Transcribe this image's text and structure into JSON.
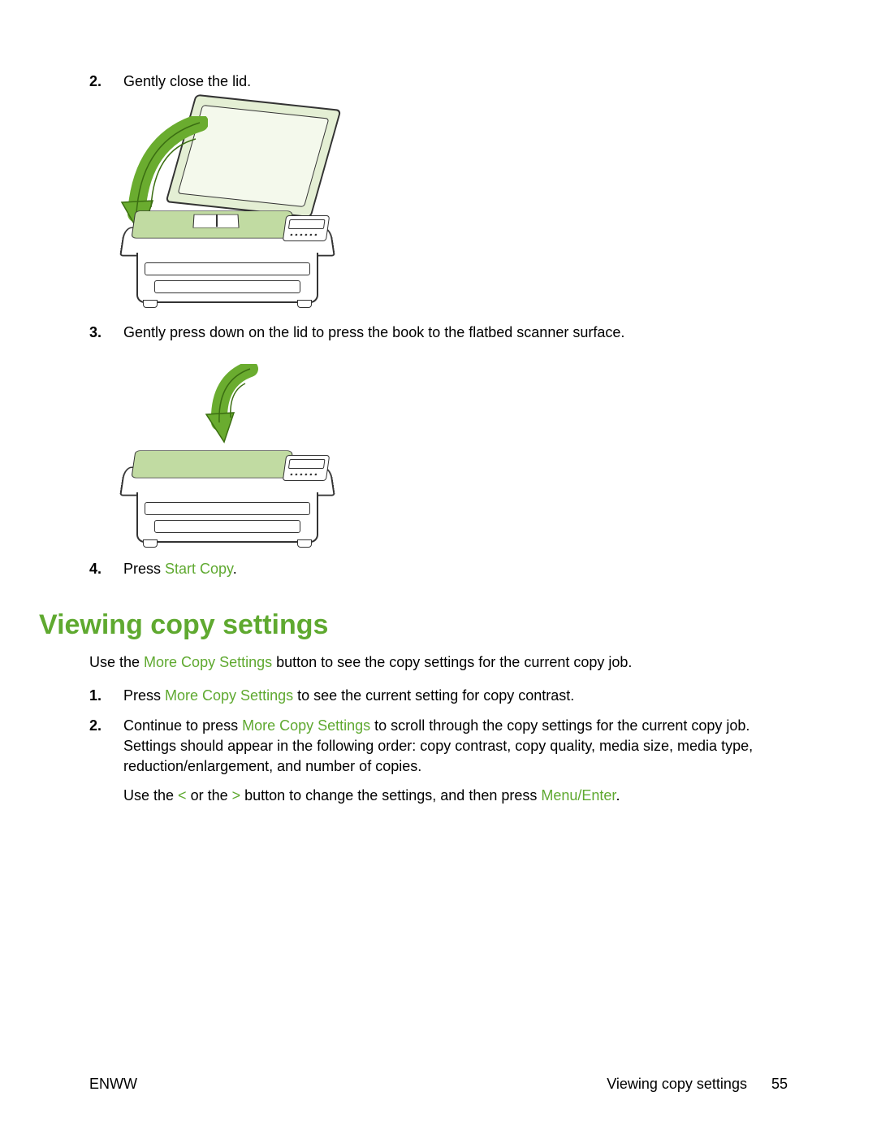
{
  "accent_color": "#5fa930",
  "steps_a": {
    "s2": {
      "num": "2.",
      "text": "Gently close the lid."
    },
    "s3": {
      "num": "3.",
      "text": "Gently press down on the lid to press the book to the flatbed scanner surface."
    },
    "s4": {
      "num": "4.",
      "prefix": "Press ",
      "link": "Start Copy",
      "suffix": "."
    }
  },
  "section": {
    "heading": "Viewing copy settings",
    "intro_a": "Use the ",
    "intro_link": "More Copy Settings",
    "intro_b": " button to see the copy settings for the current copy job."
  },
  "steps_b": {
    "s1": {
      "num": "1.",
      "a": "Press ",
      "link": "More Copy Settings",
      "b": " to see the current setting for copy contrast."
    },
    "s2": {
      "num": "2.",
      "a": "Continue to press ",
      "link": "More Copy Settings",
      "b": " to scroll through the copy settings for the current copy job. Settings should appear in the following order: copy contrast, copy quality, media size, media type, reduction/enlargement, and number of copies.",
      "p2_a": "Use the ",
      "p2_lt": "<",
      "p2_mid": " or the ",
      "p2_gt": ">",
      "p2_b": " button to change the settings, and then press ",
      "p2_link": "Menu/Enter",
      "p2_c": "."
    }
  },
  "footer": {
    "left": "ENWW",
    "right_text": "Viewing copy settings",
    "page": "55"
  },
  "icons": {
    "fig1": "printer-close-lid-illustration",
    "fig2": "printer-press-lid-illustration"
  }
}
